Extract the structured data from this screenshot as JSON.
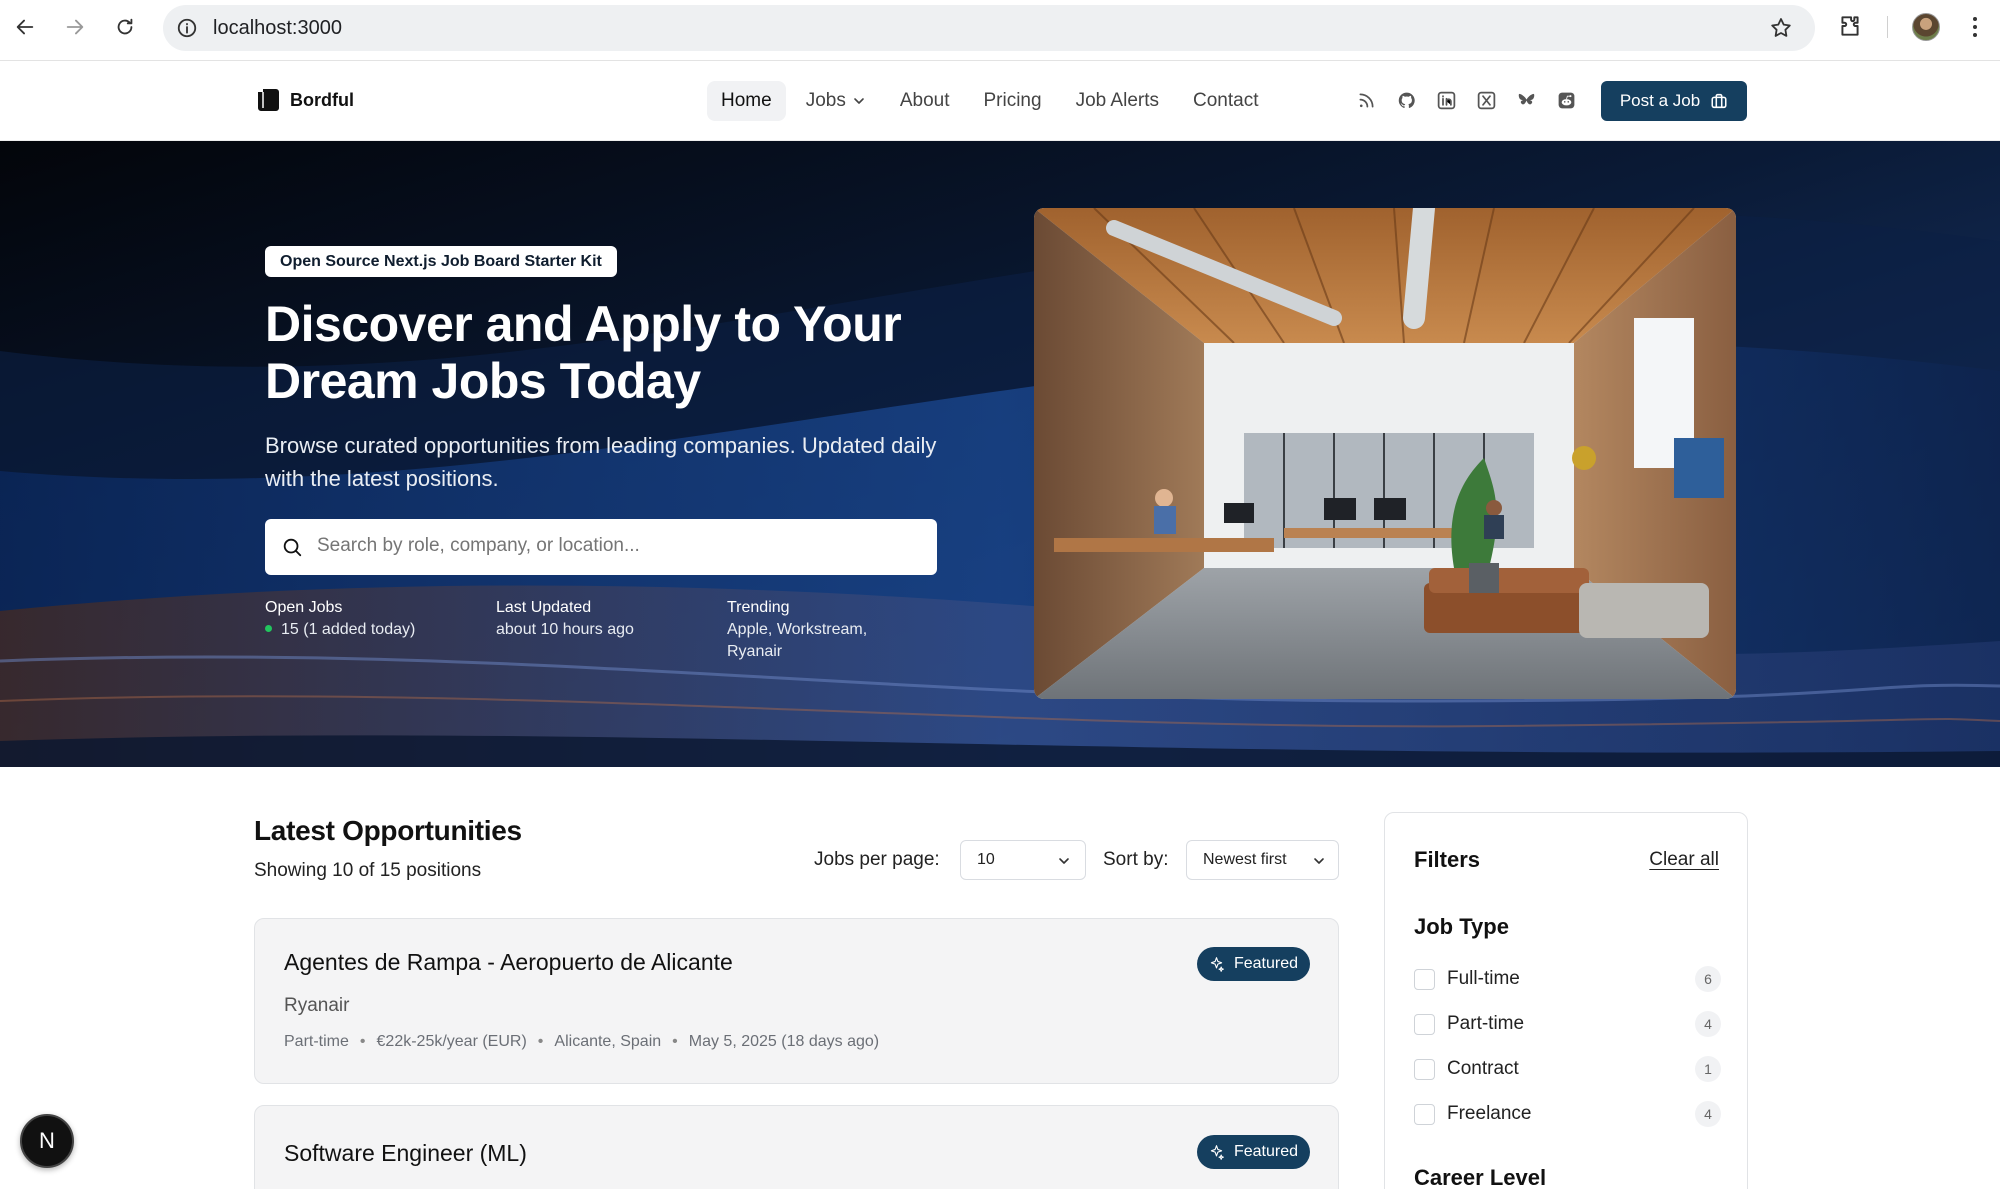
{
  "browser": {
    "url": "localhost:3000"
  },
  "header": {
    "brand": "Bordful",
    "nav": [
      {
        "label": "Home",
        "active": true
      },
      {
        "label": "Jobs",
        "has_dropdown": true
      },
      {
        "label": "About"
      },
      {
        "label": "Pricing"
      },
      {
        "label": "Job Alerts"
      },
      {
        "label": "Contact"
      }
    ],
    "social_icons": [
      "rss-icon",
      "github-icon",
      "linkedin-icon",
      "x-icon",
      "bluesky-icon",
      "reddit-icon"
    ],
    "post_button": "Post a Job",
    "accent_color": "#153f5f"
  },
  "hero": {
    "badge": "Open Source Next.js Job Board Starter Kit",
    "title": "Discover and Apply to Your Dream Jobs Today",
    "subtitle": "Browse curated opportunities from leading companies. Updated daily with the latest positions.",
    "search_placeholder": "Search by role, company, or location...",
    "stats": [
      {
        "label": "Open Jobs",
        "value": "15 (1 added today)"
      },
      {
        "label": "Last Updated",
        "value": "about 10 hours ago"
      },
      {
        "label": "Trending",
        "value": "Apple, Workstream, Ryanair"
      }
    ]
  },
  "listing": {
    "title": "Latest Opportunities",
    "subtitle": "Showing 10 of 15 positions",
    "per_page_label": "Jobs per page:",
    "per_page_value": "10",
    "sort_label": "Sort by:",
    "sort_value": "Newest first",
    "jobs": [
      {
        "title": "Agentes de Rampa - Aeropuerto de Alicante",
        "company": "Ryanair",
        "type": "Part-time",
        "salary": "€22k-25k/year (EUR)",
        "location": "Alicante, Spain",
        "posted": "May 5, 2025 (18 days ago)",
        "badge": "Featured"
      },
      {
        "title": "Software Engineer (ML)",
        "company": "",
        "badge": "Featured"
      }
    ]
  },
  "filters": {
    "title": "Filters",
    "clear": "Clear all",
    "job_type_title": "Job Type",
    "job_types": [
      {
        "label": "Full-time",
        "count": "6"
      },
      {
        "label": "Part-time",
        "count": "4"
      },
      {
        "label": "Contract",
        "count": "1"
      },
      {
        "label": "Freelance",
        "count": "4"
      }
    ],
    "career_level_title": "Career Level"
  },
  "dev_indicator": "N"
}
